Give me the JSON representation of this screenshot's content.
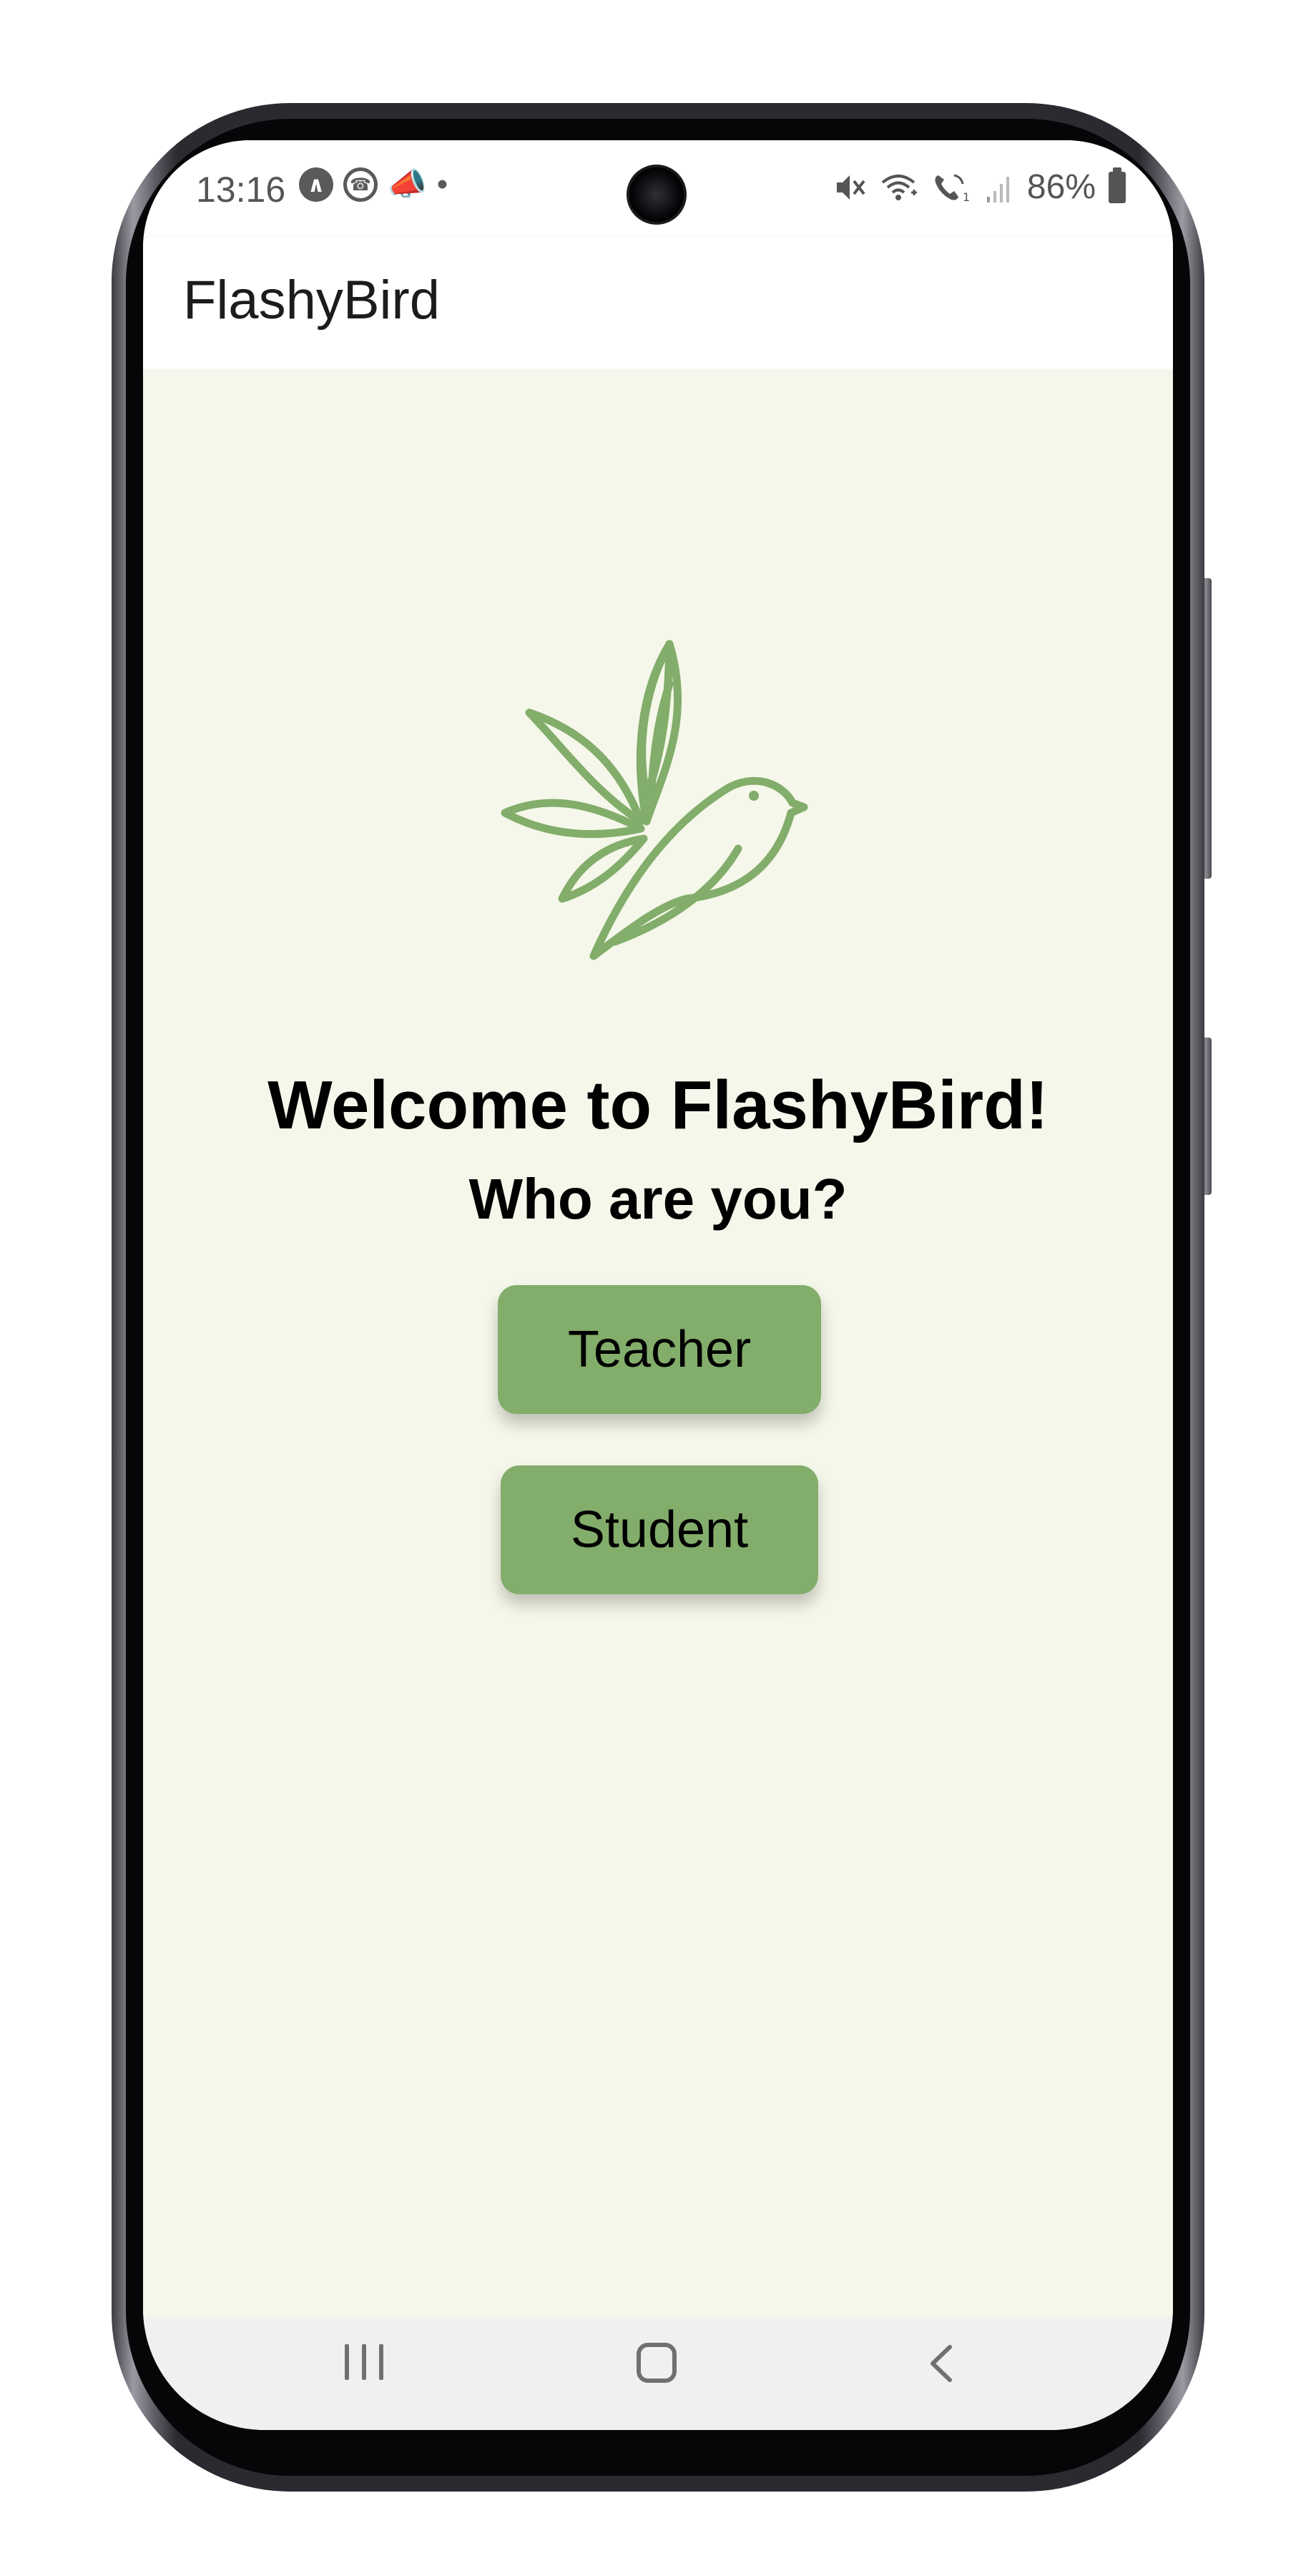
{
  "status_bar": {
    "time": "13:16",
    "battery": "86%",
    "left_icons": [
      "android-auto-icon",
      "whatsapp-icon",
      "megaphone-icon",
      "dot-icon"
    ],
    "right_icons": [
      "mute-icon",
      "wifi-call-icon",
      "volte-call-icon",
      "signal-icon",
      "battery-icon"
    ]
  },
  "app_bar": {
    "title": "FlashyBird"
  },
  "main": {
    "welcome": "Welcome to FlashyBird!",
    "question": "Who are you?",
    "teacher_button": "Teacher",
    "student_button": "Student"
  },
  "colors": {
    "accent": "#82ad6a",
    "background": "#f5f7ea",
    "app_bar": "#ffffff",
    "nav_bar": "#f0f0f0"
  }
}
